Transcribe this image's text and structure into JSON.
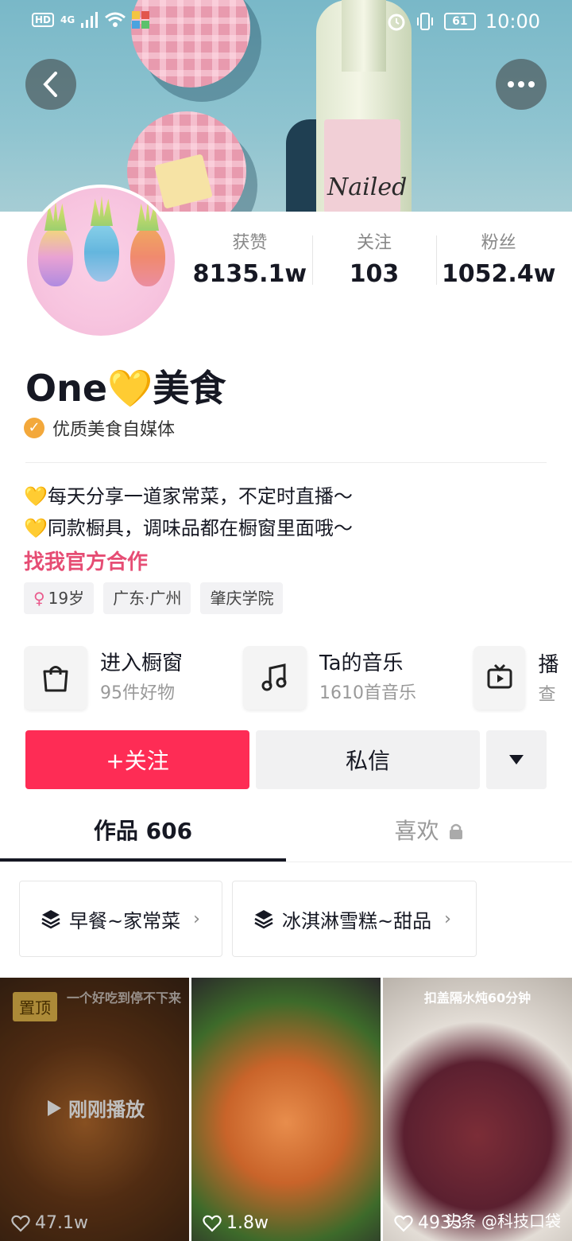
{
  "status_bar": {
    "hd": "HD",
    "network": "4G",
    "battery": "61",
    "time": "10:00"
  },
  "banner": {
    "bottle_label": "Nailed"
  },
  "profile": {
    "name": "One💛美食",
    "verified_label": "优质美食自媒体",
    "stats": [
      {
        "label": "获赞",
        "value": "8135.1w"
      },
      {
        "label": "关注",
        "value": "103"
      },
      {
        "label": "粉丝",
        "value": "1052.4w"
      }
    ],
    "bio_lines": [
      "💛每天分享一道家常菜，不定时直播～",
      "💛同款橱具，调味品都在橱窗里面哦～"
    ],
    "cooperation_link": "找我官方合作",
    "tags": {
      "age_symbol": "♀",
      "age": "19岁",
      "location": "广东·广州",
      "school": "肇庆学院"
    }
  },
  "shortcuts": [
    {
      "title": "进入橱窗",
      "subtitle": "95件好物",
      "icon": "shopping-bag-icon"
    },
    {
      "title": "Ta的音乐",
      "subtitle": "1610首音乐",
      "icon": "music-note-icon"
    },
    {
      "title": "直播",
      "subtitle": "查看",
      "icon": "tv-icon"
    }
  ],
  "actions": {
    "follow": "+关注",
    "message": "私信"
  },
  "tabs": {
    "works": "作品 606",
    "likes": "喜欢"
  },
  "collections": [
    {
      "label": "早餐~家常菜"
    },
    {
      "label": "冰淇淋雪糕~甜品"
    }
  ],
  "videos": [
    {
      "pinned": "置顶",
      "top_text": "一个好吃到停不下来",
      "overlay": "刚刚播放",
      "likes": "47.1w"
    },
    {
      "likes": "1.8w"
    },
    {
      "top_text": "扣盖隔水炖60分钟",
      "likes": "4933"
    }
  ],
  "watermark": "头条 @科技口袋",
  "colors": {
    "follow_red": "#fe2c55",
    "coop_pink": "#e64d74",
    "verify_orange": "#f3a83b"
  }
}
